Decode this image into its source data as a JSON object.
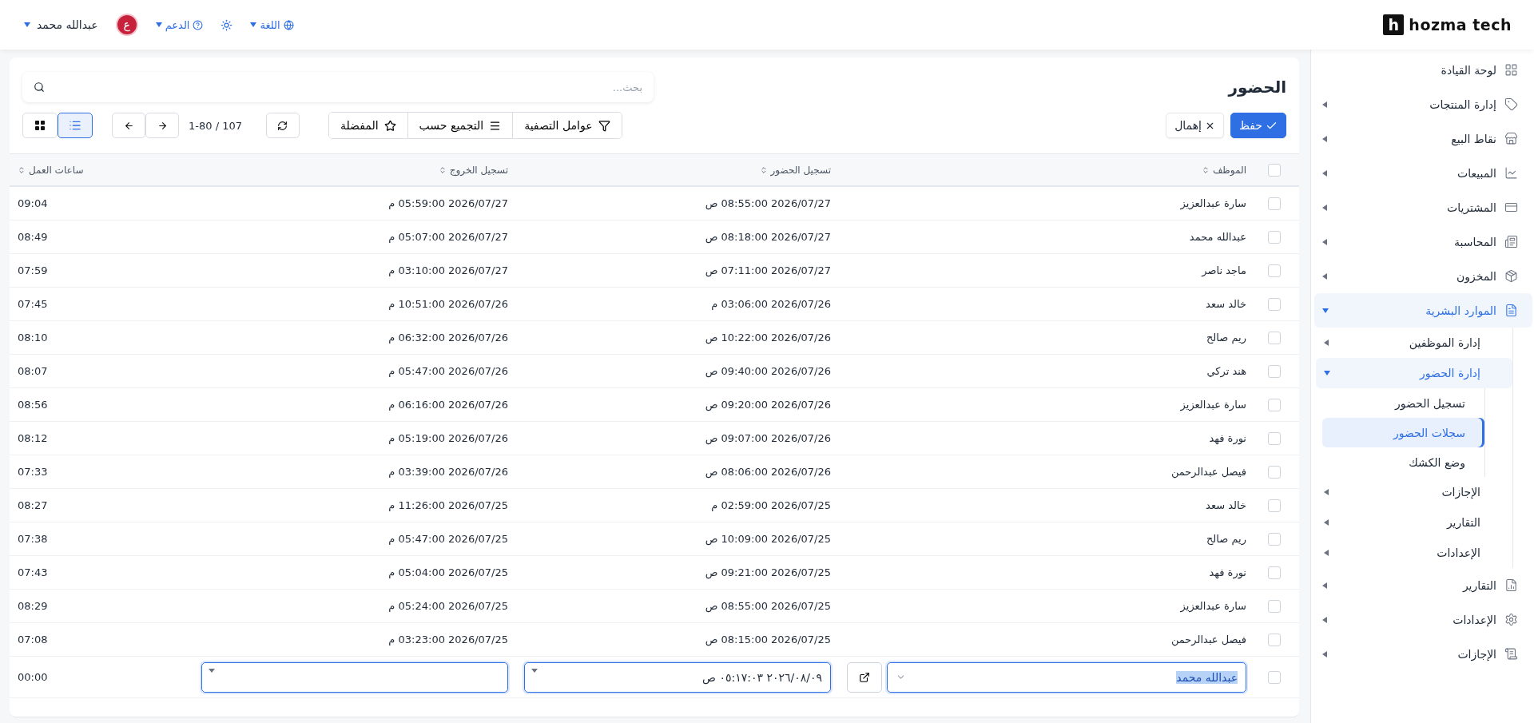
{
  "brand": {
    "name": "hozma tech",
    "mark": "h"
  },
  "topbar": {
    "language": "اللغة",
    "support": "الدعم",
    "user": {
      "name": "عبدالله محمد",
      "initial": "ع"
    }
  },
  "sidebar": {
    "items": [
      {
        "label": "لوحة القيادة",
        "kind": "link",
        "selected": false
      },
      {
        "label": "إدارة المنتجات",
        "kind": "group",
        "expanded": false,
        "selected": false
      },
      {
        "label": "نقاط البيع",
        "kind": "group",
        "expanded": false,
        "selected": false
      },
      {
        "label": "المبيعات",
        "kind": "group",
        "expanded": false,
        "selected": false
      },
      {
        "label": "المشتريات",
        "kind": "group",
        "expanded": false,
        "selected": false
      },
      {
        "label": "المحاسبة",
        "kind": "group",
        "expanded": false,
        "selected": false
      },
      {
        "label": "المخزون",
        "kind": "group",
        "expanded": false,
        "selected": false
      },
      {
        "label": "الموارد البشرية",
        "kind": "group",
        "expanded": true,
        "selected": false,
        "children": [
          {
            "label": "إدارة الموظفين",
            "kind": "group",
            "expanded": false,
            "selected": false
          },
          {
            "label": "إدارة الحضور",
            "kind": "group",
            "expanded": true,
            "selected": false,
            "children": [
              {
                "label": "تسجيل الحضور",
                "kind": "link",
                "selected": false
              },
              {
                "label": "سجلات الحضور",
                "kind": "link",
                "selected": true
              },
              {
                "label": "وضع الكشك",
                "kind": "link",
                "selected": false
              }
            ]
          },
          {
            "label": "الإجازات",
            "kind": "group",
            "expanded": false,
            "selected": false
          },
          {
            "label": "التقارير",
            "kind": "group",
            "expanded": false,
            "selected": false
          },
          {
            "label": "الإعدادات",
            "kind": "group",
            "expanded": false,
            "selected": false
          }
        ]
      },
      {
        "label": "التقارير",
        "kind": "group",
        "expanded": false,
        "selected": false
      },
      {
        "label": "الإعدادات",
        "kind": "group",
        "expanded": false,
        "selected": false
      },
      {
        "label": "الإجازات",
        "kind": "group",
        "expanded": false,
        "selected": false
      }
    ]
  },
  "page": {
    "title": "الحضور",
    "search": {
      "placeholder": "بحث..."
    }
  },
  "toolbar": {
    "save": "حفظ",
    "discard": "إهمال",
    "filters": "عوامل التصفية",
    "group_by": "التجميع حسب",
    "favorites": "المفضلة",
    "pager": "1-80 / 107",
    "views": [
      {
        "kind": "list",
        "selected": true
      },
      {
        "kind": "grid",
        "selected": false
      }
    ]
  },
  "table": {
    "all_checked": false,
    "columns": [
      "الموظف",
      "تسجيل الحضور",
      "تسجيل الخروج",
      "ساعات العمل"
    ],
    "rows": [
      {
        "checked": false,
        "cells": [
          "سارة عبدالعزيز",
          "2026/07/27 08:55:00 ص",
          "2026/07/27 05:59:00 م",
          "09:04"
        ]
      },
      {
        "checked": false,
        "cells": [
          "عبدالله محمد",
          "2026/07/27 08:18:00 ص",
          "2026/07/27 05:07:00 م",
          "08:49"
        ]
      },
      {
        "checked": false,
        "cells": [
          "ماجد ناصر",
          "2026/07/27 07:11:00 ص",
          "2026/07/27 03:10:00 م",
          "07:59"
        ]
      },
      {
        "checked": false,
        "cells": [
          "خالد سعد",
          "2026/07/26 03:06:00 م",
          "2026/07/26 10:51:00 م",
          "07:45"
        ]
      },
      {
        "checked": false,
        "cells": [
          "ريم صالح",
          "2026/07/26 10:22:00 ص",
          "2026/07/26 06:32:00 م",
          "08:10"
        ]
      },
      {
        "checked": false,
        "cells": [
          "هند تركي",
          "2026/07/26 09:40:00 ص",
          "2026/07/26 05:47:00 م",
          "08:07"
        ]
      },
      {
        "checked": false,
        "cells": [
          "سارة عبدالعزيز",
          "2026/07/26 09:20:00 ص",
          "2026/07/26 06:16:00 م",
          "08:56"
        ]
      },
      {
        "checked": false,
        "cells": [
          "نورة فهد",
          "2026/07/26 09:07:00 ص",
          "2026/07/26 05:19:00 م",
          "08:12"
        ]
      },
      {
        "checked": false,
        "cells": [
          "فيصل عبدالرحمن",
          "2026/07/26 08:06:00 ص",
          "2026/07/26 03:39:00 م",
          "07:33"
        ]
      },
      {
        "checked": false,
        "cells": [
          "خالد سعد",
          "2026/07/25 02:59:00 م",
          "2026/07/25 11:26:00 م",
          "08:27"
        ]
      },
      {
        "checked": false,
        "cells": [
          "ريم صالح",
          "2026/07/25 10:09:00 ص",
          "2026/07/25 05:47:00 م",
          "07:38"
        ]
      },
      {
        "checked": false,
        "cells": [
          "نورة فهد",
          "2026/07/25 09:21:00 ص",
          "2026/07/25 05:04:00 م",
          "07:43"
        ]
      },
      {
        "checked": false,
        "cells": [
          "سارة عبدالعزيز",
          "2026/07/25 08:55:00 ص",
          "2026/07/25 05:24:00 م",
          "08:29"
        ]
      },
      {
        "checked": false,
        "cells": [
          "فيصل عبدالرحمن",
          "2026/07/25 08:15:00 ص",
          "2026/07/25 03:23:00 م",
          "07:08"
        ]
      }
    ],
    "new_row": {
      "checked": false,
      "employee": "عبدالله محمد",
      "check_in": "٢٠٢٦/٠٨/٠٩ ٠٥:١٧:٠٣ ص",
      "hours": "00:00"
    }
  }
}
